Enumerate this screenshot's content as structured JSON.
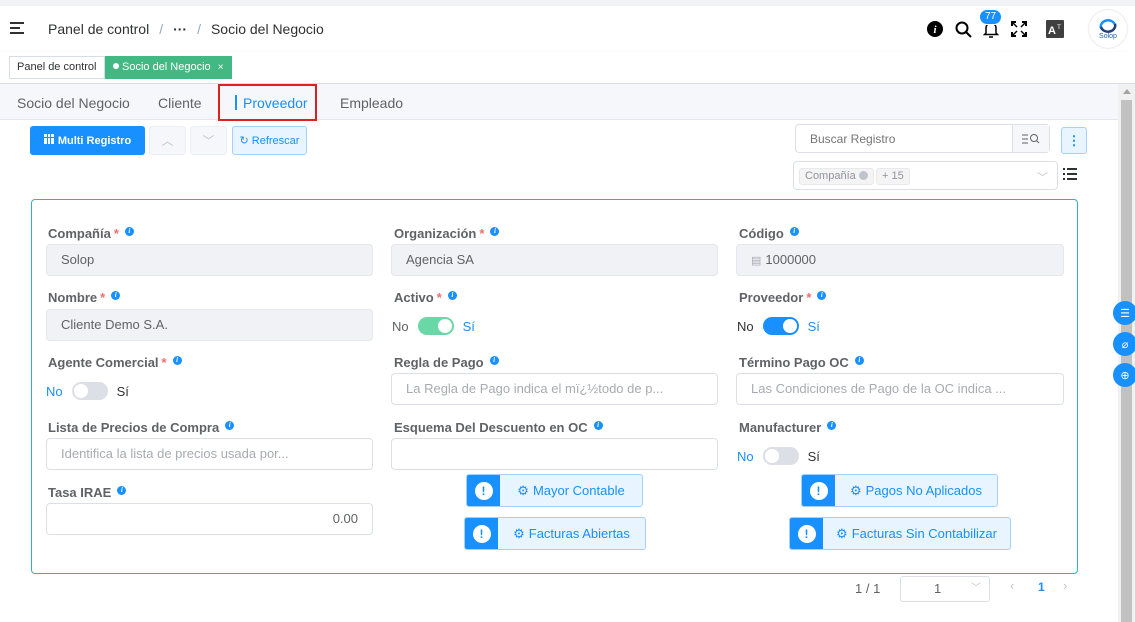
{
  "header": {
    "breadcrumb": [
      "Panel de control",
      "···",
      "Socio del Negocio"
    ],
    "notification_count": "77",
    "logo_text": "Solop"
  },
  "tags": {
    "items": [
      "Panel de control",
      "Socio del Negocio"
    ],
    "close_mark": "×"
  },
  "tabs": [
    "Socio del Negocio",
    "Cliente",
    "Proveedor",
    "Empleado"
  ],
  "toolbar": {
    "multi_label": "Multi Registro",
    "refresh_label": "Refrescar",
    "search_placeholder": "Buscar Registro",
    "filter_chip": "Compañía",
    "filter_more": "+ 15"
  },
  "form": {
    "company": {
      "label": "Compañía",
      "value": "Solop"
    },
    "organization": {
      "label": "Organización",
      "value": "Agencia SA"
    },
    "code": {
      "label": "Código",
      "value": "1000000"
    },
    "name": {
      "label": "Nombre",
      "value": "Cliente Demo S.A."
    },
    "active": {
      "label": "Activo",
      "off": "No",
      "on": "Sí",
      "value": true
    },
    "vendor": {
      "label": "Proveedor",
      "off": "No",
      "on": "Sí",
      "value": true
    },
    "sales_agent": {
      "label": "Agente Comercial",
      "off": "No",
      "on": "Sí",
      "value": false
    },
    "payment_rule": {
      "label": "Regla de Pago",
      "placeholder": "La Regla de Pago indica el mï¿½todo de p..."
    },
    "po_terms": {
      "label": "Término Pago OC",
      "placeholder": "Las Condiciones de Pago de la OC indica ..."
    },
    "po_price_list": {
      "label": "Lista de Precios de Compra",
      "placeholder": "Identifica la lista de precios usada por..."
    },
    "po_discount": {
      "label": "Esquema Del Descuento en OC",
      "value": ""
    },
    "manufacturer": {
      "label": "Manufacturer",
      "off": "No",
      "on": "Sí",
      "value": false
    },
    "irae": {
      "label": "Tasa IRAE",
      "value": "0.00"
    }
  },
  "actions": {
    "general_ledger": "Mayor Contable",
    "unapplied_payments": "Pagos No Aplicados",
    "open_invoices": "Facturas Abiertas",
    "unposted_invoices": "Facturas Sin Contabilizar"
  },
  "pagination": {
    "record_count": "1 / 1",
    "page_select": "1",
    "current_page": "1"
  },
  "colors": {
    "accent": "#1890ff",
    "tag_active": "#42b983",
    "card_border": "#36b1b8",
    "highlight": "#e02020"
  }
}
